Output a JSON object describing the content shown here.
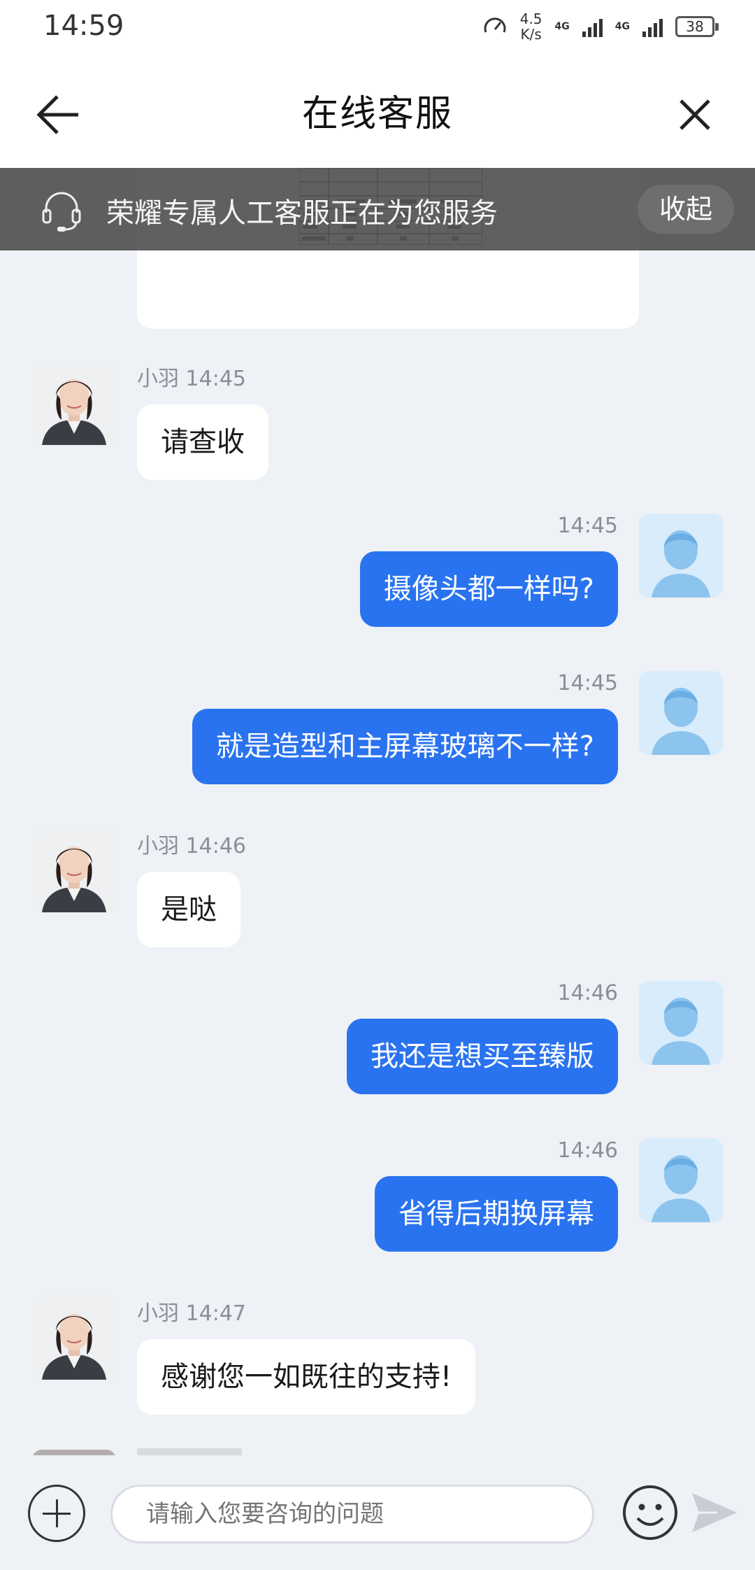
{
  "status_bar": {
    "time": "14:59",
    "speed_value": "4.5",
    "speed_unit": "K/s",
    "net1": "4G",
    "net2": "4G",
    "battery": "38"
  },
  "header": {
    "title": "在线客服"
  },
  "notice": {
    "text": "荣耀专属人工客服正在为您服务",
    "collapse_label": "收起"
  },
  "messages": [
    {
      "side": "agent",
      "sender": "小羽",
      "time": "14:45",
      "text": "请查收"
    },
    {
      "side": "user",
      "time": "14:45",
      "text": "摄像头都一样吗?"
    },
    {
      "side": "user",
      "time": "14:45",
      "text": "就是造型和主屏幕玻璃不一样?"
    },
    {
      "side": "agent",
      "sender": "小羽",
      "time": "14:46",
      "text": "是哒"
    },
    {
      "side": "user",
      "time": "14:46",
      "text": "我还是想买至臻版"
    },
    {
      "side": "user",
      "time": "14:46",
      "text": "省得后期换屏幕"
    },
    {
      "side": "agent",
      "sender": "小羽",
      "time": "14:47",
      "text": "感谢您一如既往的支持!"
    }
  ],
  "input": {
    "placeholder": "请输入您要咨询的问题"
  },
  "colors": {
    "user_bubble": "#2a73f0",
    "agent_bubble": "#ffffff",
    "background": "#eef1f5"
  }
}
